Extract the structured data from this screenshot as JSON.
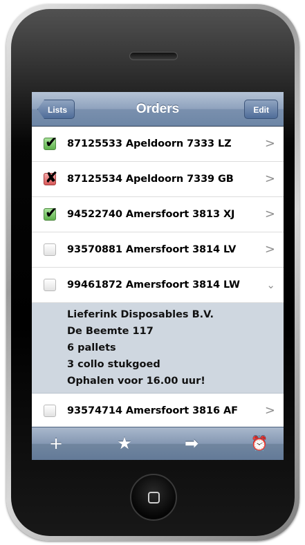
{
  "navbar": {
    "title": "Orders",
    "back_label": "Lists",
    "edit_label": "Edit"
  },
  "orders": [
    {
      "text": "87125533 Apeldoorn 7333 LZ",
      "status": "checked",
      "mark": "✔",
      "disclosure": ">"
    },
    {
      "text": "87125534 Apeldoorn 7339 GB",
      "status": "rejected",
      "mark": "✘",
      "disclosure": ">"
    },
    {
      "text": "94522740 Amersfoort 3813 XJ",
      "status": "checked",
      "mark": "✔",
      "disclosure": ">"
    },
    {
      "text": "93570881 Amersfoort 3814 LV",
      "status": "unchecked",
      "mark": "",
      "disclosure": ">"
    },
    {
      "text": "99461872 Amersfoort 3814 LW",
      "status": "unchecked",
      "mark": "",
      "disclosure": "⌄"
    },
    {
      "text": "93574714 Amersfoort 3816 AF",
      "status": "unchecked",
      "mark": "",
      "disclosure": ">"
    }
  ],
  "expanded_detail": [
    "Lieferink Disposables B.V.",
    "De Beemte 117",
    "6 pallets",
    "3 collo stukgoed",
    "Ophalen voor 16.00 uur!"
  ],
  "toolbar": {
    "add": "+",
    "favorite": "★",
    "forward": "➡",
    "alarm": "⏰"
  },
  "colors": {
    "navbar": "#7a90ae",
    "detail_bg": "#cfd7e0",
    "check": "#5fb24c",
    "reject": "#d95a5a"
  }
}
